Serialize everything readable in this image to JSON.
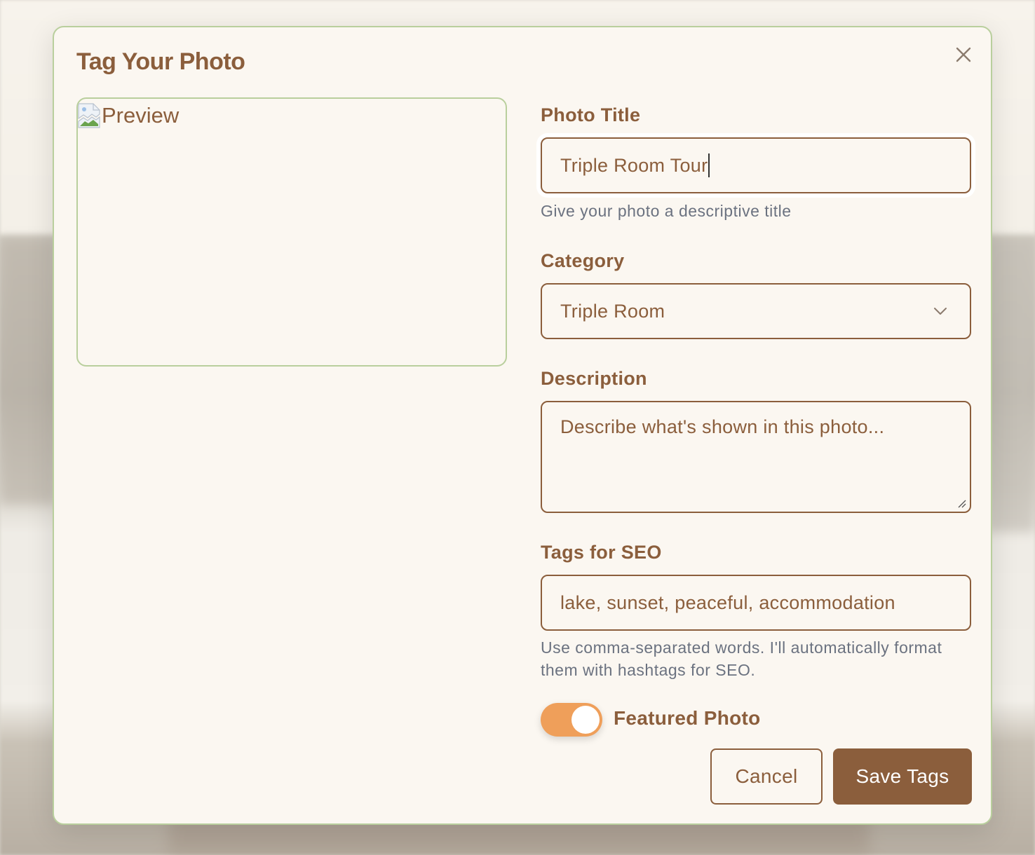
{
  "modal": {
    "title": "Tag Your Photo",
    "close_icon": "close-icon"
  },
  "preview": {
    "alt_text": "Preview",
    "icon": "broken-image-icon"
  },
  "form": {
    "title": {
      "label": "Photo Title",
      "value": "Triple Room Tour",
      "helper": "Give your photo a descriptive title"
    },
    "category": {
      "label": "Category",
      "selected": "Triple Room",
      "icon": "chevron-down-icon"
    },
    "description": {
      "label": "Description",
      "placeholder": "Describe what's shown in this photo..."
    },
    "tags": {
      "label": "Tags for SEO",
      "value": "lake, sunset, peaceful, accommodation",
      "helper_line1": "Use comma-separated words. I'll automatically format",
      "helper_line2": "them with hashtags for SEO."
    },
    "featured": {
      "label": "Featured Photo",
      "on": true
    }
  },
  "actions": {
    "cancel_label": "Cancel",
    "save_label": "Save Tags"
  },
  "colors": {
    "accent_brown": "#8b5e3c",
    "border_green": "#b9cf9d",
    "toggle_orange": "#ef9f5a",
    "modal_bg": "#fbf7f1",
    "helper_gray": "#6b7280"
  }
}
